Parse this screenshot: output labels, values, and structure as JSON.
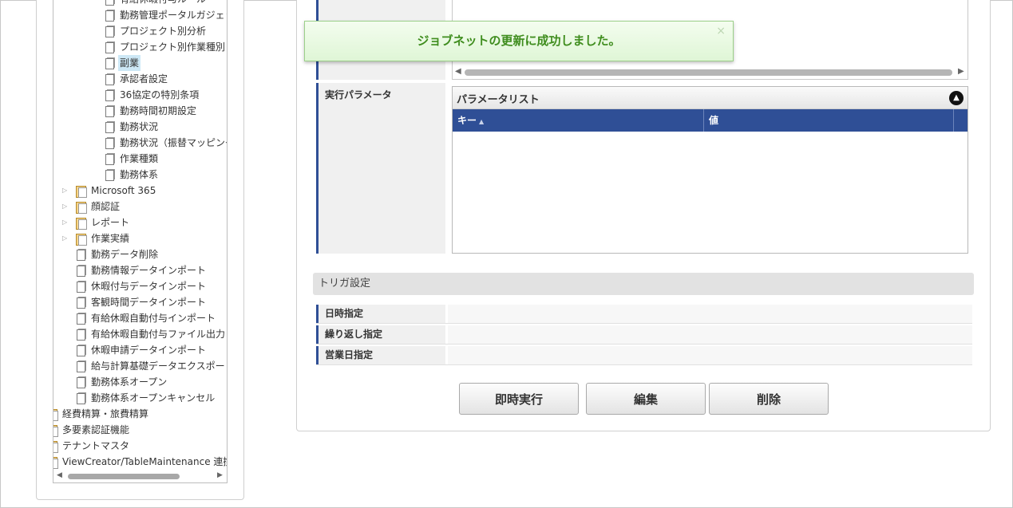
{
  "tree": {
    "items": [
      {
        "label": "有給休暇付与ルール",
        "kind": "doc",
        "indent": 2
      },
      {
        "label": "勤務管理ポータルガジェット",
        "kind": "doc",
        "indent": 2
      },
      {
        "label": "プロジェクト別分析",
        "kind": "doc",
        "indent": 2
      },
      {
        "label": "プロジェクト別作業種別",
        "kind": "doc",
        "indent": 2
      },
      {
        "label": "副業",
        "kind": "doc",
        "indent": 2,
        "selected": true
      },
      {
        "label": "承認者設定",
        "kind": "doc",
        "indent": 2
      },
      {
        "label": "36協定の特別条項",
        "kind": "doc",
        "indent": 2
      },
      {
        "label": "勤務時間初期設定",
        "kind": "doc",
        "indent": 2
      },
      {
        "label": "勤務状況",
        "kind": "doc",
        "indent": 2
      },
      {
        "label": "勤務状況（振替マッピング）",
        "kind": "doc",
        "indent": 2
      },
      {
        "label": "作業種類",
        "kind": "doc",
        "indent": 2
      },
      {
        "label": "勤務体系",
        "kind": "doc",
        "indent": 2
      },
      {
        "label": "Microsoft 365",
        "kind": "folder",
        "indent": 1
      },
      {
        "label": "顔認証",
        "kind": "folder",
        "indent": 1
      },
      {
        "label": "レポート",
        "kind": "folder",
        "indent": 1
      },
      {
        "label": "作業実績",
        "kind": "folder",
        "indent": 1
      },
      {
        "label": "勤務データ削除",
        "kind": "doc",
        "indent": 1
      },
      {
        "label": "勤務情報データインポート",
        "kind": "doc",
        "indent": 1
      },
      {
        "label": "休暇付与データインポート",
        "kind": "doc",
        "indent": 1
      },
      {
        "label": "客観時間データインポート",
        "kind": "doc",
        "indent": 1
      },
      {
        "label": "有給休暇自動付与インポート",
        "kind": "doc",
        "indent": 1
      },
      {
        "label": "有給休暇自動付与ファイル出力",
        "kind": "doc",
        "indent": 1
      },
      {
        "label": "休暇申請データインポート",
        "kind": "doc",
        "indent": 1
      },
      {
        "label": "給与計算基礎データエクスポート",
        "kind": "doc",
        "indent": 1
      },
      {
        "label": "勤務体系オープン",
        "kind": "doc",
        "indent": 1
      },
      {
        "label": "勤務体系オープンキャンセル",
        "kind": "doc",
        "indent": 1
      },
      {
        "label": "経費精算・旅費精算",
        "kind": "folder",
        "indent": 0
      },
      {
        "label": "多要素認証機能",
        "kind": "folder",
        "indent": 0
      },
      {
        "label": "テナントマスタ",
        "kind": "folder",
        "indent": 0
      },
      {
        "label": "ViewCreator/TableMaintenance 連携",
        "kind": "folder",
        "indent": 0
      }
    ]
  },
  "toast": {
    "message": "ジョブネットの更新に成功しました。",
    "close": "×"
  },
  "params": {
    "row_label": "実行パラメータ",
    "list_title": "パラメータリスト",
    "col_key": "キー",
    "col_value": "値"
  },
  "trigger": {
    "section_title": "トリガ設定",
    "rows": [
      "日時指定",
      "繰り返し指定",
      "営業日指定"
    ]
  },
  "buttons": {
    "run_now": "即時実行",
    "edit": "編集",
    "delete": "削除"
  },
  "colors": {
    "accent": "#2f4f96",
    "toast_text": "#3f8d1e",
    "selected": "#cde8f6"
  }
}
